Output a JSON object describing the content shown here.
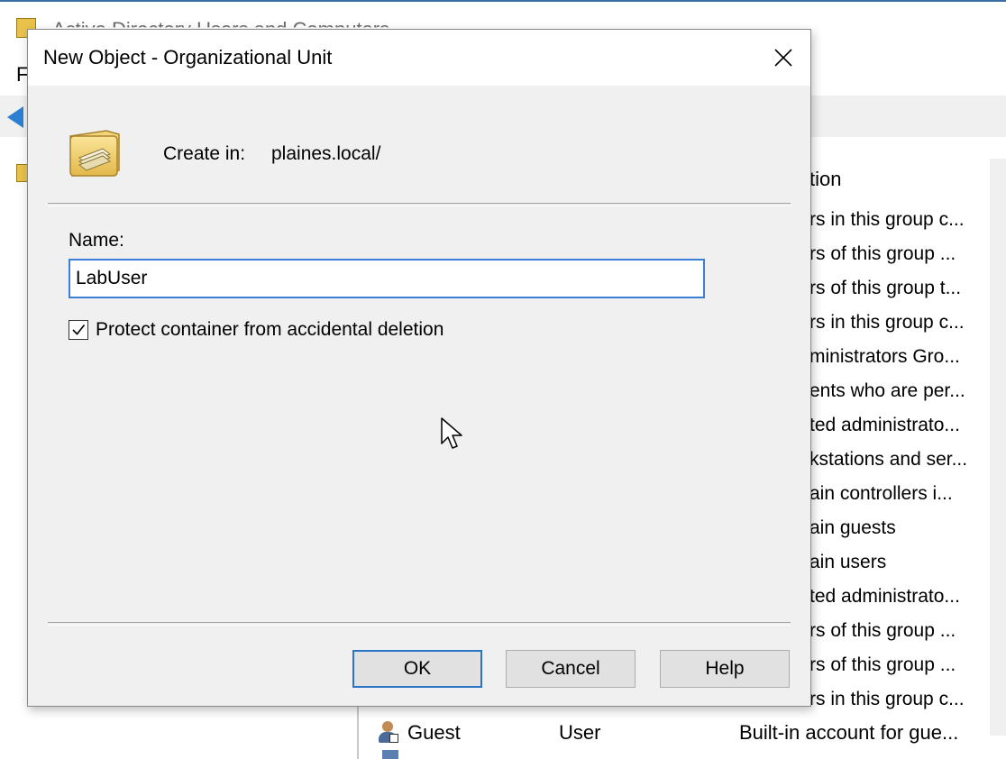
{
  "background_window": {
    "title": "Active Directory Users and Computers",
    "menu_first_letter": "F",
    "list_column_header": "tion",
    "descriptions": [
      "rs in this group c...",
      "rs of this group ...",
      "rs of this group t...",
      "rs in this group c...",
      "ministrators Gro...",
      "ents who are per...",
      "ted administrato...",
      "kstations and ser...",
      "ain controllers i...",
      "ain guests",
      "ain users",
      "ted administrato...",
      "rs of this group ...",
      "rs of this group ...",
      "rs in this group c..."
    ],
    "guest_row": {
      "name": "Guest",
      "type": "User",
      "description": "Built-in account for gue..."
    }
  },
  "dialog": {
    "title": "New Object - Organizational Unit",
    "create_in_label": "Create in:",
    "create_in_path": "plaines.local/",
    "name_label": "Name:",
    "name_value": "LabUser",
    "protect_label": "Protect container from accidental deletion",
    "protect_checked": true,
    "ok_label": "OK",
    "cancel_label": "Cancel",
    "help_label": "Help"
  },
  "icons": {
    "close": "close-icon",
    "ou": "organizational-unit-icon",
    "check": "checkmark-icon",
    "cursor": "mouse-pointer-icon",
    "user": "user-icon"
  },
  "colors": {
    "accent": "#2a73c9",
    "dialog_background": "#f0f0f0"
  }
}
